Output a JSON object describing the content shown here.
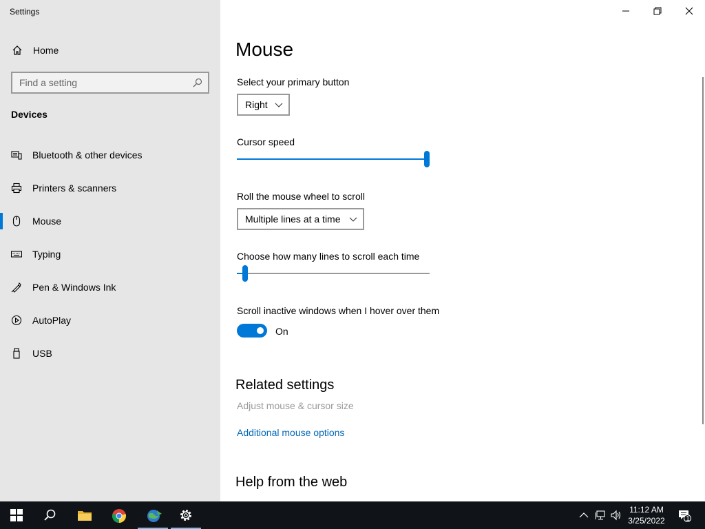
{
  "window": {
    "title": "Settings"
  },
  "sidebar": {
    "home_label": "Home",
    "search_placeholder": "Find a setting",
    "section_title": "Devices",
    "items": [
      {
        "label": "Bluetooth & other devices",
        "icon": "bluetooth-devices-icon"
      },
      {
        "label": "Printers & scanners",
        "icon": "printer-icon"
      },
      {
        "label": "Mouse",
        "icon": "mouse-icon",
        "active": true
      },
      {
        "label": "Typing",
        "icon": "keyboard-icon"
      },
      {
        "label": "Pen & Windows Ink",
        "icon": "pen-icon"
      },
      {
        "label": "AutoPlay",
        "icon": "autoplay-icon"
      },
      {
        "label": "USB",
        "icon": "usb-icon"
      }
    ]
  },
  "main": {
    "title": "Mouse",
    "primary_button": {
      "label": "Select your primary button",
      "value": "Right"
    },
    "cursor_speed": {
      "label": "Cursor speed",
      "value_fraction": 1.0
    },
    "wheel_scroll": {
      "label": "Roll the mouse wheel to scroll",
      "value": "Multiple lines at a time"
    },
    "lines_scroll": {
      "label": "Choose how many lines to scroll each time",
      "value_fraction": 0.03
    },
    "inactive_scroll": {
      "label": "Scroll inactive windows when I hover over them",
      "state": "On"
    },
    "related": {
      "title": "Related settings",
      "adjust_link": "Adjust mouse & cursor size",
      "additional_link": "Additional mouse options"
    },
    "help_title": "Help from the web"
  },
  "taskbar": {
    "time": "11:12 AM",
    "date": "3/25/2022",
    "notification_count": "1"
  },
  "colors": {
    "accent": "#0078d7",
    "link": "#0067b8",
    "sidebar_bg": "#e6e6e6",
    "taskbar_bg": "#101418"
  }
}
